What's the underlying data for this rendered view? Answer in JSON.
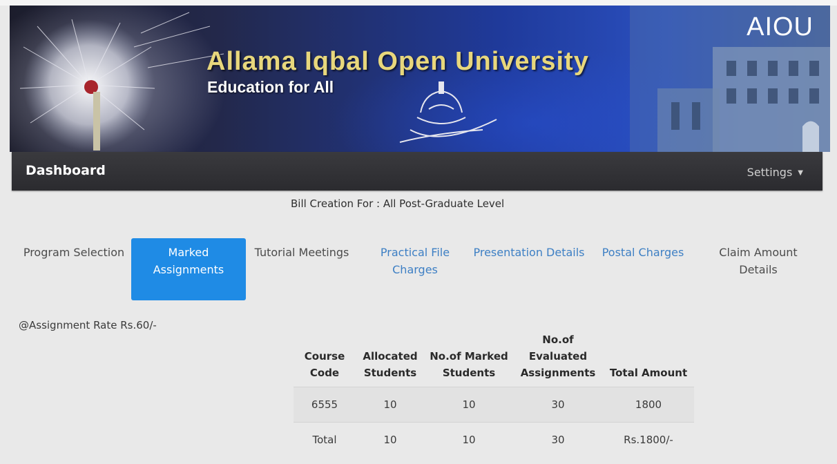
{
  "banner": {
    "logo_text": "AIOU",
    "title": "Allama Iqbal Open University",
    "subtitle": "Education for All",
    "title_color": "#e8d77c"
  },
  "navbar": {
    "brand": "Dashboard",
    "settings_label": "Settings",
    "settings_icon": "caret-down-icon"
  },
  "bill_creation": "Bill Creation For : All Post-Graduate Level",
  "tabs": [
    {
      "label": "Program Selection"
    },
    {
      "label": "Marked Assignments",
      "active": true
    },
    {
      "label": "Tutorial Meetings"
    },
    {
      "label": "Practical File Charges"
    },
    {
      "label": "Presentation Details"
    },
    {
      "label": "Postal Charges"
    },
    {
      "label": "Claim Amount Details"
    }
  ],
  "assignment_rate": "@Assignment Rate Rs.60/-",
  "table": {
    "headers": [
      "Course Code",
      "Allocated Students",
      "No.of Marked Students",
      "No.of Evaluated Assignments",
      "Total Amount"
    ],
    "rows": [
      [
        "6555",
        "10",
        "10",
        "30",
        "1800"
      ],
      [
        "Total",
        "10",
        "10",
        "30",
        "Rs.1800/-"
      ]
    ]
  },
  "colors": {
    "active_tab": "#1f8be5",
    "link_tab": "#3d7fc4",
    "navbar": "#2f2f33"
  }
}
